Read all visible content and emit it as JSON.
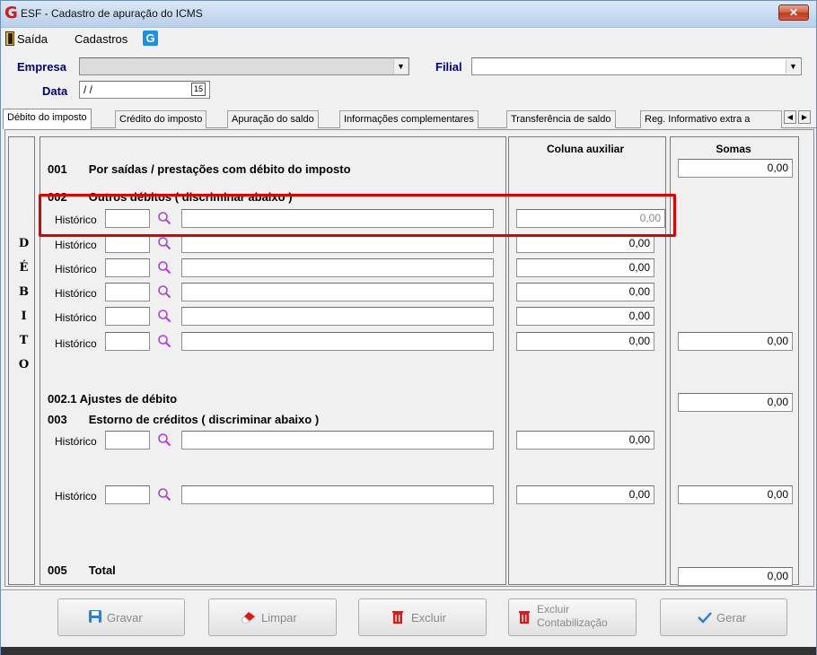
{
  "window": {
    "title": "ESF - Cadastro de apuração do ICMS",
    "close_label": "✕"
  },
  "menu": {
    "items": [
      "Saída",
      "Cadastros"
    ]
  },
  "header": {
    "empresa_label": "Empresa",
    "filial_label": "Filial",
    "data_label": "Data",
    "data_value": "/ /",
    "calendar_label": "15"
  },
  "tabs": [
    "Débito do imposto",
    "Crédito do imposto",
    "Apuração do saldo",
    "Informações complementares",
    "Transferência de saldo",
    "Reg. Informativo extra a"
  ],
  "side_letters": [
    "D",
    "É",
    "B",
    "I",
    "T",
    "O"
  ],
  "columns": {
    "aux": "Coluna auxiliar",
    "somas": "Somas"
  },
  "sections": {
    "s001": "001     Por saídas / prestações com débito do imposto",
    "s002": "002     Outros débitos ( discriminar abaixo )",
    "s0021": "002.1  Ajustes de débito",
    "s003": "003     Estorno de créditos ( discriminar abaixo )",
    "s005": "005     Total"
  },
  "historico_label": "Histórico",
  "values": {
    "soma_001": "0,00",
    "aux_rows": [
      "0,00",
      "0,00",
      "0,00",
      "0,00",
      "0,00",
      "0,00"
    ],
    "soma_002": "0,00",
    "soma_0021": "0,00",
    "aux_003a": "0,00",
    "aux_003b": "0,00",
    "soma_003": "0,00",
    "soma_005": "0,00"
  },
  "buttons": {
    "gravar": "Gravar",
    "limpar": "Limpar",
    "excluir": "Excluir",
    "excluir_contab_1": "Excluir",
    "excluir_contab_2": "Contabilização",
    "gerar": "Gerar"
  },
  "colors": {
    "highlight": "#e00000",
    "label_blue": "#00007a",
    "magnifier": "#b23fd8"
  }
}
